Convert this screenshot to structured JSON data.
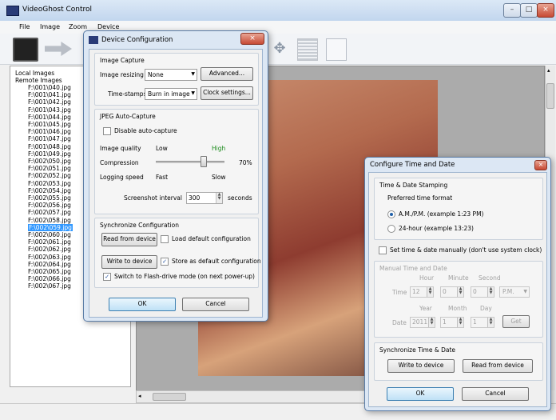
{
  "app": {
    "title": "VideoGhost Control"
  },
  "menu": [
    "File",
    "Image",
    "Zoom",
    "Device"
  ],
  "tree": {
    "local": "Local Images",
    "remote": "Remote Images",
    "items": [
      "F:\\001\\040.jpg",
      "F:\\001\\041.jpg",
      "F:\\001\\042.jpg",
      "F:\\001\\043.jpg",
      "F:\\001\\044.jpg",
      "F:\\001\\045.jpg",
      "F:\\001\\046.jpg",
      "F:\\001\\047.jpg",
      "F:\\001\\048.jpg",
      "F:\\001\\049.jpg",
      "F:\\002\\050.jpg",
      "F:\\002\\051.jpg",
      "F:\\002\\052.jpg",
      "F:\\002\\053.jpg",
      "F:\\002\\054.jpg",
      "F:\\002\\055.jpg",
      "F:\\002\\056.jpg",
      "F:\\002\\057.jpg",
      "F:\\002\\058.jpg",
      "F:\\002\\059.jpg",
      "F:\\002\\060.jpg",
      "F:\\002\\061.jpg",
      "F:\\002\\062.jpg",
      "F:\\002\\063.jpg",
      "F:\\002\\064.jpg",
      "F:\\002\\065.jpg",
      "F:\\002\\066.jpg",
      "F:\\002\\067.jpg"
    ],
    "selected": "F:\\002\\059.jpg"
  },
  "device_config": {
    "title": "Device Configuration",
    "image_capture": {
      "header": "Image Capture",
      "resizing_label": "Image resizing",
      "resizing_value": "None",
      "advanced": "Advanced...",
      "timestamps_label": "Time-stamps",
      "timestamps_value": "Burn in image",
      "clock_settings": "Clock settings..."
    },
    "jpeg": {
      "header": "JPEG Auto-Capture",
      "disable_auto": "Disable auto-capture",
      "quality_label": "Image quality",
      "low": "Low",
      "high": "High",
      "compression_label": "Compression",
      "compression_value": "70%",
      "logging_label": "Logging speed",
      "fast": "Fast",
      "slow": "Slow",
      "interval_label": "Screenshot interval",
      "interval_value": "300",
      "interval_unit": "seconds"
    },
    "sync": {
      "header": "Synchronize Configuration",
      "read": "Read from device",
      "load_default": "Load default configuration",
      "write": "Write to device",
      "store_default": "Store as default configuration",
      "flash": "Switch to Flash-drive mode (on next power-up)"
    },
    "ok": "OK",
    "cancel": "Cancel"
  },
  "time_config": {
    "title": "Configure Time and Date",
    "stamping": {
      "header": "Time & Date Stamping",
      "preferred": "Preferred time format",
      "ampm": "A.M./P.M. (example 1:23 PM)",
      "h24": "24-hour (example 13:23)"
    },
    "manual_check": "Set time & date manually (don't use system clock)",
    "manual": {
      "header": "Manual Time and Date",
      "hour": "Hour",
      "minute": "Minute",
      "second": "Second",
      "time_label": "Time",
      "hour_val": "12",
      "min_val": "0",
      "sec_val": "0",
      "ampm_val": "P.M.",
      "year": "Year",
      "month": "Month",
      "day": "Day",
      "date_label": "Date",
      "year_val": "2011",
      "month_val": "1",
      "day_val": "1",
      "get": "Get"
    },
    "sync": {
      "header": "Synchronize Time & Date",
      "write": "Write to device",
      "read": "Read from device"
    },
    "ok": "OK",
    "cancel": "Cancel"
  }
}
